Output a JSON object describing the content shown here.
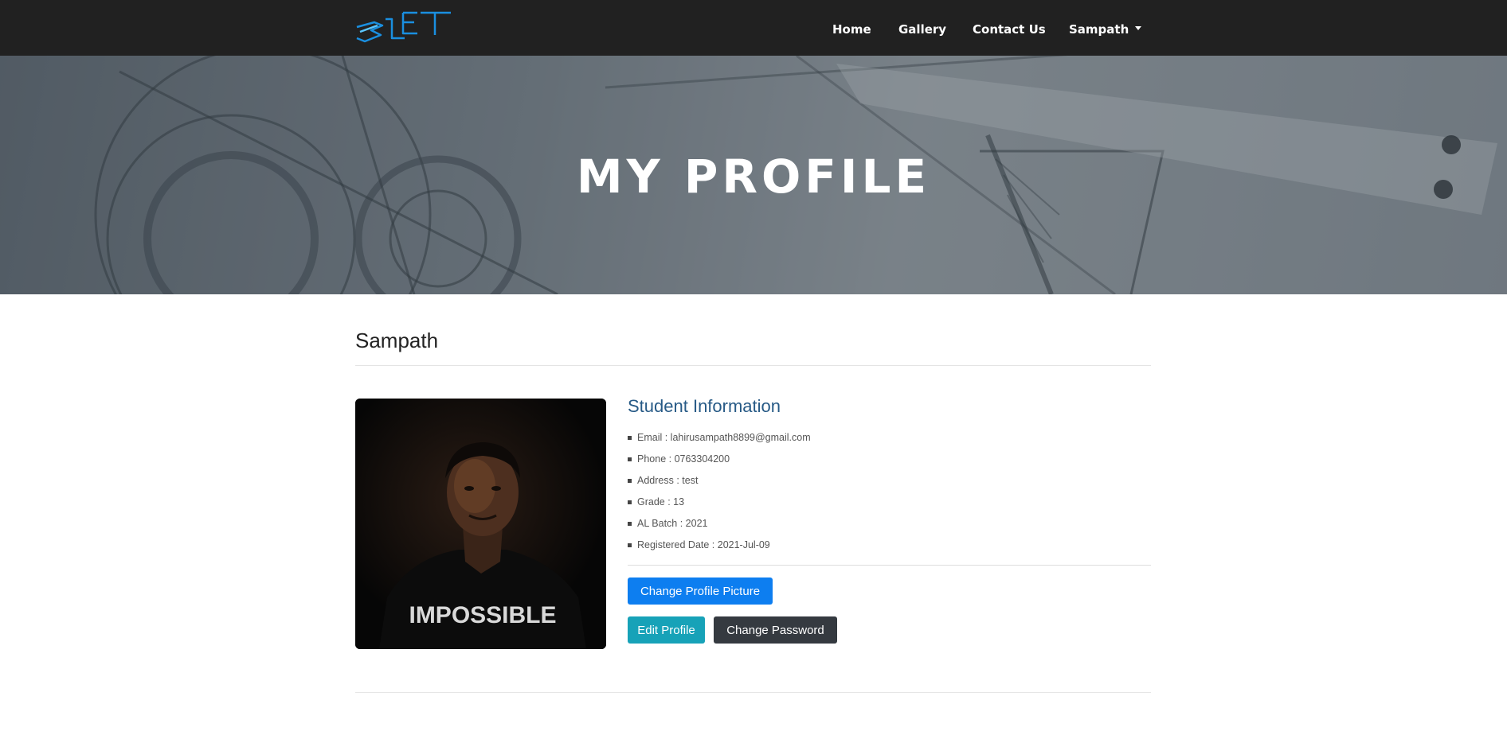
{
  "nav": {
    "logo_text": "SLET",
    "links": [
      {
        "label": "Home"
      },
      {
        "label": "Gallery"
      },
      {
        "label": "Contact Us"
      },
      {
        "label": "Sampath"
      }
    ]
  },
  "hero": {
    "title": "MY PROFILE"
  },
  "profile": {
    "name": "Sampath",
    "section_title": "Student Information",
    "details": [
      "Email : lahirusampath8899@gmail.com",
      "Phone : 0763304200",
      "Address : test",
      "Grade : 13",
      "AL Batch : 2021",
      "Registered Date : 2021-Jul-09"
    ],
    "photo_shirt_text": "IMPOSSIBLE"
  },
  "buttons": {
    "change_picture": "Change Profile Picture",
    "edit_profile": "Edit Profile",
    "change_password": "Change Password"
  },
  "colors": {
    "navbar": "#212121",
    "accent_title": "#275a86",
    "primary": "#0d7ef0",
    "info": "#17a2b8",
    "dark": "#353a40"
  }
}
